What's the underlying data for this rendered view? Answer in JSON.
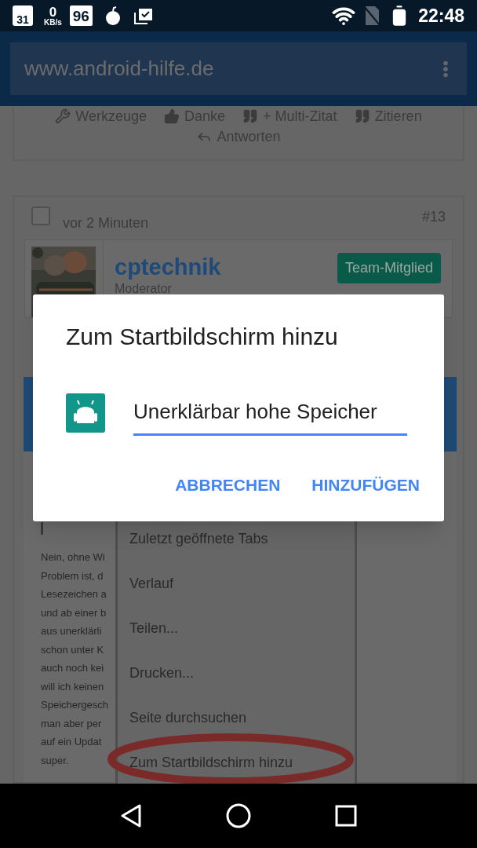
{
  "status_bar": {
    "calendar_day": "31",
    "speed_value": "0",
    "speed_unit": "KB/s",
    "badge_number": "96",
    "time": "22:48"
  },
  "browser": {
    "url": "www.android-hilfe.de"
  },
  "post_actions": [
    {
      "kind": "tools",
      "label": "Werkzeuge"
    },
    {
      "kind": "thanks",
      "label": "Danke"
    },
    {
      "kind": "quote",
      "label": "+ Multi-Zitat"
    },
    {
      "kind": "quote",
      "label": "Zitieren"
    },
    {
      "kind": "reply",
      "label": "Antworten"
    }
  ],
  "post": {
    "checked": false,
    "time": "vor 2 Minuten",
    "number": "#13",
    "author": "cptechnik",
    "role": "Moderator",
    "badge": "Team-Mitglied",
    "embedded_screenshot": {
      "text_lines": [
        "Nein, ohne Wi",
        "Problem ist, d",
        "Lesezeichen a",
        "und ab einer b",
        "aus unerklärli",
        "schon unter K",
        "auch noch kei",
        "will ich keinen",
        "Speichergesch",
        "man aber per",
        "auf ein Updat",
        "super."
      ],
      "menu_items": [
        "Zuletzt geöffnete Tabs",
        "Verlauf",
        "Teilen...",
        "Drucken...",
        "Seite durchsuchen",
        "Zum Startbildschirm hinzu"
      ]
    }
  },
  "dialog": {
    "title": "Zum Startbildschirm hinzu",
    "name_value": "Unerklärbar hohe Speicher",
    "buttons": [
      "ABBRECHEN",
      "HINZUFÜGEN"
    ]
  }
}
